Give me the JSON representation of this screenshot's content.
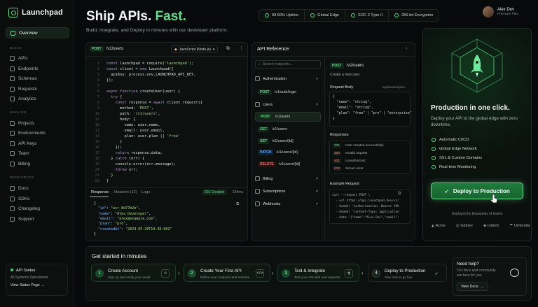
{
  "brand": {
    "name": "Launchpad"
  },
  "header": {
    "title_main": "Ship APIs.",
    "title_accent": "Fast.",
    "subtitle": "Build, Integrate, and Deploy in minutes with our developer platform.",
    "badges": [
      "99.99% Uptime",
      "Global Edge",
      "SOC 2 Type II",
      "256-bit Encryption"
    ]
  },
  "user": {
    "name": "Alex Dev",
    "plan": "Premium Plan"
  },
  "sidebar": {
    "overview": "Overview",
    "sections": [
      {
        "title": "BUILD",
        "items": [
          "APIs",
          "Endpoints",
          "Schemas",
          "Requests",
          "Analytics"
        ]
      },
      {
        "title": "MANAGE",
        "items": [
          "Projects",
          "Environments",
          "API Keys",
          "Team",
          "Billing"
        ]
      },
      {
        "title": "RESOURCES",
        "items": [
          "Docs",
          "SDKs",
          "Changelog",
          "Support"
        ]
      }
    ],
    "status": {
      "title": "API Status",
      "text": "All Systems Operational",
      "link": "View Status Page"
    }
  },
  "code": {
    "method": "POST",
    "path": "/v1/users",
    "language": "JavaScript (Node.js)",
    "lines": [
      [
        "1",
        "const launchpad = require('launchpad');"
      ],
      [
        "2",
        "const client = new Launchpad({"
      ],
      [
        "3",
        "  apiKey: process.env.LAUNCHPAD_API_KEY,"
      ],
      [
        "4",
        "});"
      ],
      [
        "5",
        ""
      ],
      [
        "6",
        "async function createUser(user) {"
      ],
      [
        "7",
        "  try {"
      ],
      [
        "8",
        "    const response = await client.request({"
      ],
      [
        "9",
        "      method: 'POST',"
      ],
      [
        "10",
        "      path: '/v1/users',"
      ],
      [
        "11",
        "      body: {"
      ],
      [
        "12",
        "        name: user.name,"
      ],
      [
        "13",
        "        email: user.email,"
      ],
      [
        "14",
        "        plan: user.plan || 'free'"
      ],
      [
        "15",
        "      }"
      ],
      [
        "16",
        "    });"
      ],
      [
        "17",
        "    return response.data;"
      ],
      [
        "18",
        "  } catch (err) {"
      ],
      [
        "19",
        "    console.error(err.message);"
      ],
      [
        "20",
        "    throw err;"
      ],
      [
        "21",
        "  }"
      ],
      [
        "22",
        "}"
      ]
    ],
    "tabs": [
      "Response",
      "Headers (12)",
      "Logs"
    ],
    "status": "201 Created",
    "time": "134ms",
    "response": [
      "{",
      "  \"id\": \"usr_8d77b2e\",",
      "  \"name\": \"Alex Developer\",",
      "  \"email\": \"alex@example.com\",",
      "  \"plan\": \"pro\",",
      "  \"createdAt\": \"2024-05-20T10:30:00Z\"",
      "}"
    ]
  },
  "ref": {
    "title": "API Reference",
    "search": "Search endpoints...",
    "groups": [
      "Authentication",
      "Users",
      "Billing",
      "Subscriptions",
      "Webhooks"
    ],
    "auth_items": [
      {
        "m": "POST",
        "p": "/v1/auth/login"
      }
    ],
    "user_items": [
      {
        "m": "POST",
        "p": "/v1/users"
      },
      {
        "m": "GET",
        "p": "/v1/users"
      },
      {
        "m": "GET",
        "p": "/v1/users/{id}"
      },
      {
        "m": "PATCH",
        "p": "/v1/users/{id}"
      },
      {
        "m": "DELETE",
        "p": "/v1/users/{id}"
      }
    ],
    "detail": {
      "method": "POST",
      "path": "/v1/users",
      "desc": "Create a new user.",
      "body_label": "Request Body",
      "body_type": "application/json",
      "body": [
        "{",
        "  \"name\": \"string\",",
        "  \"email\": \"string\",",
        "  \"plan\": \"free\" | \"pro\" | \"enterprise\"",
        "}"
      ],
      "responses_label": "Responses",
      "responses": [
        {
          "code": "201",
          "text": "User created successfully"
        },
        {
          "code": "400",
          "text": "Invalid request"
        },
        {
          "code": "401",
          "text": "Unauthorized"
        },
        {
          "code": "500",
          "text": "Server error"
        }
      ],
      "example_label": "Example Request",
      "example": [
        "curl --request POST \\",
        "  --url https://api.launchpad.dev/v1/users \\",
        "  --header 'Authorization: Bearer YOUR_KEY' \\",
        "  --header 'Content-Type: application/json' \\",
        "  --data '{\"name\":\"Alex Dev\",\"email\":\"alex@"
      ]
    }
  },
  "deploy": {
    "title": "Production in one click.",
    "desc": "Deploy your API to the global edge with zero downtime.",
    "features": [
      "Automatic CI/CD",
      "Global Edge Network",
      "SSL & Custom Domains",
      "Real-time Monitoring"
    ],
    "button": "Deploy to Production",
    "trusted": "Deployed by thousands of teams",
    "logos": [
      "Acme",
      "Globex",
      "Initech",
      "Umbrella"
    ]
  },
  "start": {
    "title": "Get started in minutes",
    "steps": [
      {
        "n": "1",
        "t": "Create Account",
        "s": "Sign up and verify your email"
      },
      {
        "n": "2",
        "t": "Create Your First API",
        "s": "Define your endpoint and schema"
      },
      {
        "n": "3",
        "t": "Test & Integrate",
        "s": "Test your API with real requests"
      },
      {
        "n": "4",
        "t": "Deploy to Production",
        "s": "One click to go live"
      }
    ],
    "help": {
      "title": "Need help?",
      "text": "Our docs and community are here for you.",
      "button": "View Docs"
    }
  }
}
